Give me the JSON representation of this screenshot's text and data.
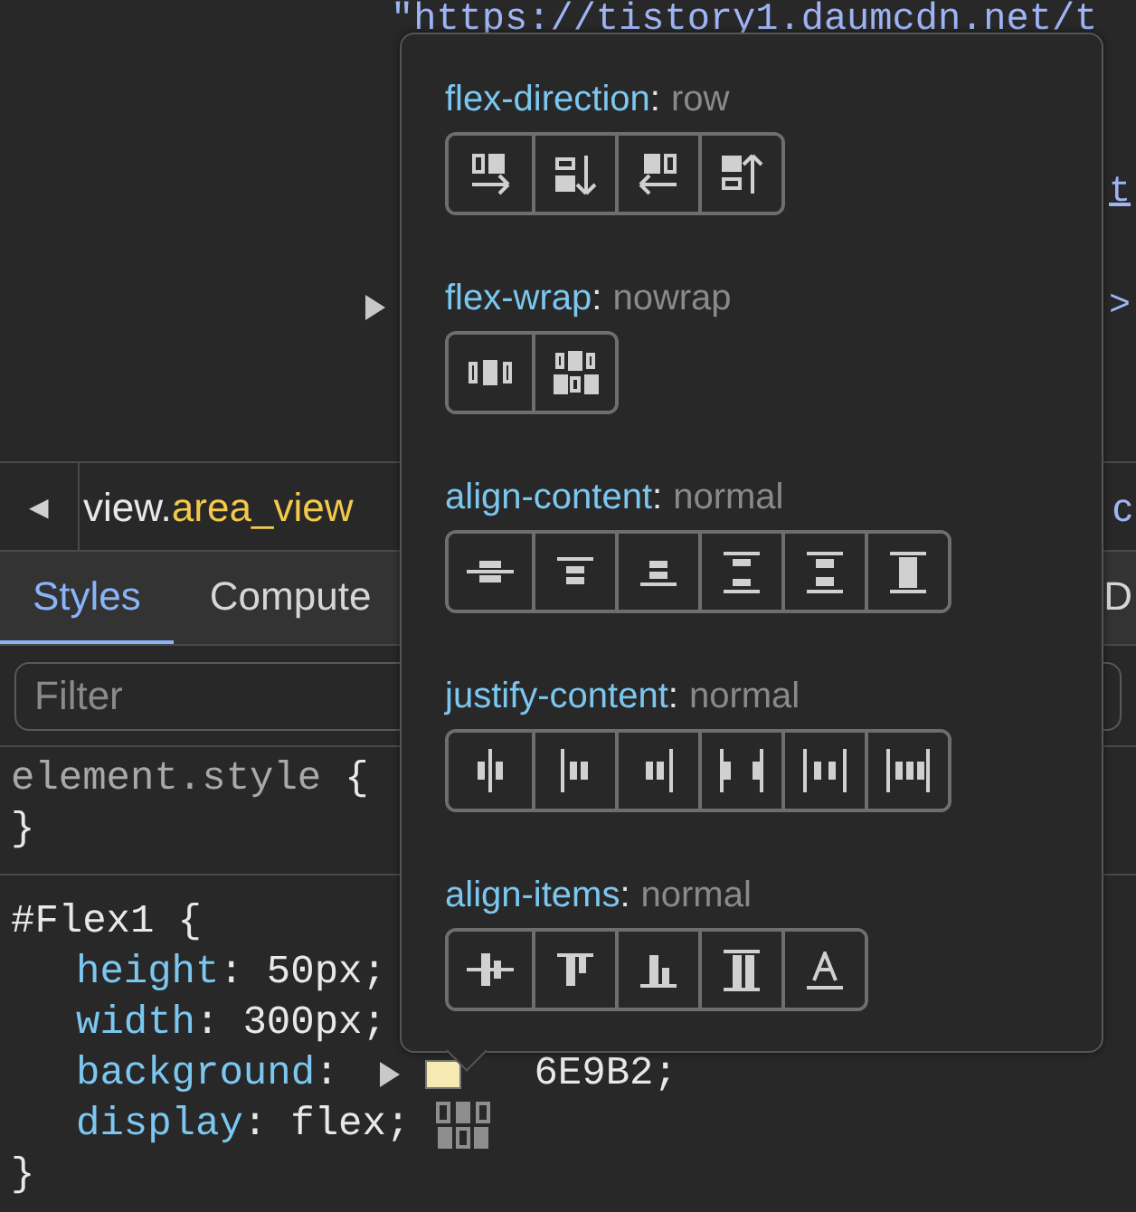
{
  "elements_panel": {
    "url_line": "\"https://tistory1.daumcdn.net/t",
    "fragments": [
      {
        "text": "t",
        "underlined": true
      },
      {
        "text": ">",
        "underlined": false
      }
    ]
  },
  "breadcrumb": {
    "back": "◀",
    "tag": "view.",
    "class_name": "area_view",
    "cut_item": "c"
  },
  "tabs": [
    {
      "label": "Styles",
      "selected": true
    },
    {
      "label": "Compute",
      "selected": false
    },
    {
      "label": "D",
      "selected": false
    }
  ],
  "filter": {
    "placeholder": "Filter"
  },
  "rules": [
    {
      "selector": "element.style",
      "open": "{",
      "close": "}"
    },
    {
      "selector": "#Flex1",
      "open": "{",
      "close": "}",
      "declarations": [
        {
          "property": "height",
          "colon": ":",
          "value": "50px;",
          "kind": "plain"
        },
        {
          "property": "width",
          "colon": ":",
          "value": "300px;",
          "kind": "plain"
        },
        {
          "property": "background",
          "colon": ":",
          "value": "6E9B2;",
          "kind": "color",
          "color": "#f6e9b2"
        },
        {
          "property": "display",
          "colon": ":",
          "value": "flex;",
          "kind": "flex"
        }
      ]
    }
  ],
  "flex_editor": {
    "sections": [
      {
        "property": "flex-direction",
        "colon": ":",
        "value": "row",
        "buttons": [
          {
            "selected": false
          },
          {
            "selected": false
          },
          {
            "selected": false
          },
          {
            "selected": false
          }
        ]
      },
      {
        "property": "flex-wrap",
        "colon": ":",
        "value": "nowrap",
        "buttons": [
          {
            "selected": false
          },
          {
            "selected": false
          }
        ]
      },
      {
        "property": "align-content",
        "colon": ":",
        "value": "normal",
        "buttons": [
          {
            "selected": false
          },
          {
            "selected": false
          },
          {
            "selected": false
          },
          {
            "selected": false
          },
          {
            "selected": false
          },
          {
            "selected": false
          }
        ]
      },
      {
        "property": "justify-content",
        "colon": ":",
        "value": "normal",
        "buttons": [
          {
            "selected": false
          },
          {
            "selected": false
          },
          {
            "selected": false
          },
          {
            "selected": false
          },
          {
            "selected": false
          },
          {
            "selected": false
          }
        ]
      },
      {
        "property": "align-items",
        "colon": ":",
        "value": "normal",
        "buttons": [
          {
            "selected": false
          },
          {
            "selected": false
          },
          {
            "selected": false
          },
          {
            "selected": false
          },
          {
            "selected": false
          }
        ]
      }
    ]
  }
}
